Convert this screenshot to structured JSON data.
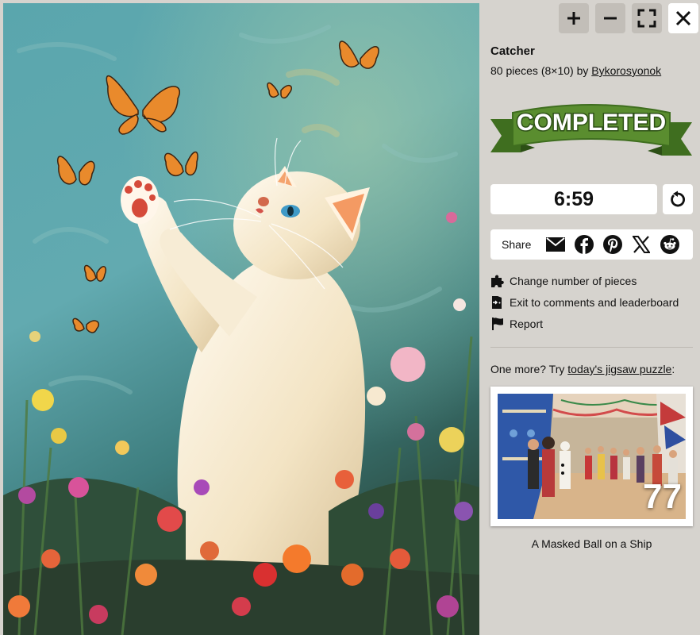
{
  "puzzle": {
    "image_alt": "Painting of a white kitten reaching up at orange butterflies among flowers"
  },
  "toolbar": {
    "zoom_in_icon": "plus-icon",
    "zoom_out_icon": "minus-icon",
    "fullscreen_icon": "fullscreen-icon",
    "close_icon": "close-icon"
  },
  "info": {
    "title": "Catcher",
    "pieces_text": "80 pieces (8×10) by ",
    "author": "Bykorosyonok"
  },
  "badge": {
    "text": "COMPLETED",
    "color": "#5a8d2f"
  },
  "timer": {
    "value": "6:59"
  },
  "share": {
    "label": "Share",
    "icons": [
      "email-icon",
      "facebook-icon",
      "pinterest-icon",
      "x-icon",
      "reddit-icon"
    ]
  },
  "links": {
    "change_pieces": "Change number of pieces",
    "exit": "Exit to comments and leaderboard",
    "report": "Report"
  },
  "more": {
    "prefix": "One more? Try ",
    "link": "today's jigsaw puzzle",
    "suffix": ":"
  },
  "next_puzzle": {
    "count": "77",
    "caption": "A Masked Ball on a Ship"
  }
}
